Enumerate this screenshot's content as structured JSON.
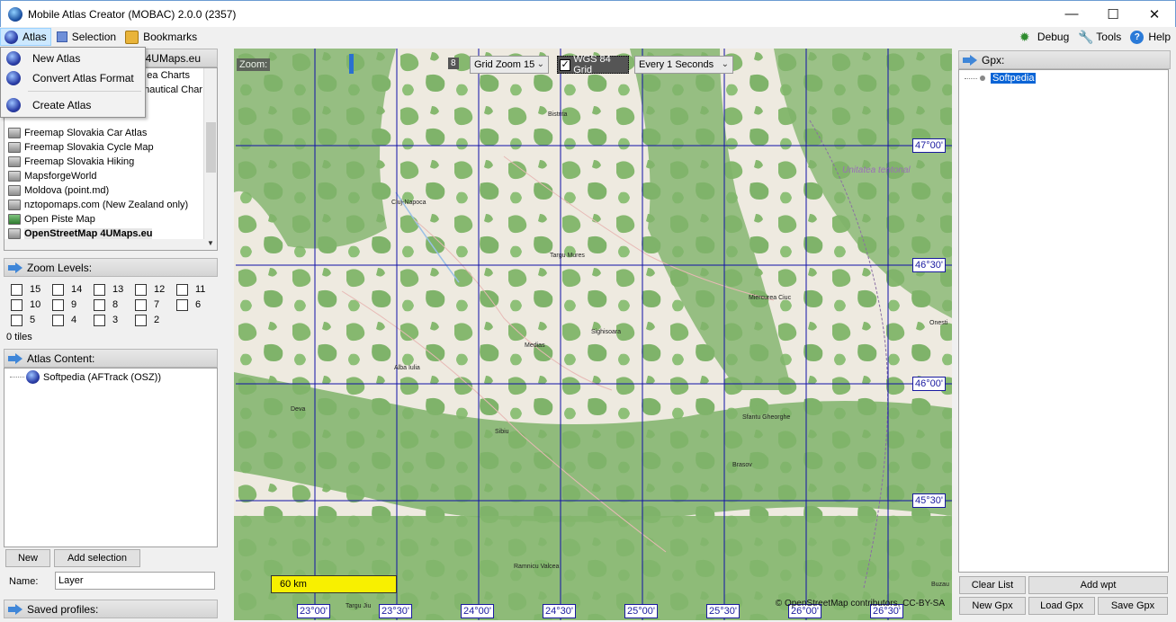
{
  "window": {
    "title": "Mobile Atlas Creator (MOBAC) 2.0.0 (2357)",
    "minimize": "—",
    "maximize": "☐",
    "close": "✕"
  },
  "menubar": {
    "atlas": "Atlas",
    "selection": "Selection",
    "bookmarks": "Bookmarks",
    "debug": "Debug",
    "tools": "Tools",
    "help": "Help"
  },
  "atlas_menu": {
    "new_atlas": "New Atlas",
    "convert_format": "Convert Atlas Format",
    "create_atlas": "Create Atlas"
  },
  "map_source": {
    "header_partial": "p 4UMaps.eu",
    "partial_items": [
      "ea Charts",
      "nautical Char"
    ],
    "items": [
      "Freemap Slovakia Car Atlas",
      "Freemap Slovakia Cycle Map",
      "Freemap Slovakia Hiking",
      "MapsforgeWorld",
      "Moldova (point.md)",
      "nztopomaps.com (New Zealand only)",
      "Open Piste Map",
      "OpenStreetMap 4UMaps.eu"
    ]
  },
  "zoom_levels": {
    "header": "Zoom Levels:",
    "levels": [
      "15",
      "14",
      "13",
      "12",
      "11",
      "10",
      "9",
      "8",
      "7",
      "6",
      "5",
      "4",
      "3",
      "2"
    ],
    "tiles": "0 tiles"
  },
  "atlas_content": {
    "header": "Atlas Content:",
    "item": "Softpedia (AFTrack (OSZ))",
    "new_button": "New",
    "add_selection_button": "Add selection",
    "name_label": "Name:",
    "name_value": "Layer"
  },
  "saved_profiles": {
    "header": "Saved profiles:"
  },
  "map": {
    "zoom_label": "Zoom:",
    "zoom_value": "8",
    "grid_zoom": "Grid Zoom 15",
    "grid_type": "WGS 84 Grid",
    "grid_checked": true,
    "refresh": "Every 1 Seconds",
    "lat_labels": [
      "47°00'",
      "46°30'",
      "46°00'",
      "45°30'"
    ],
    "lon_labels": [
      "23°00'",
      "23°30'",
      "24°00'",
      "24°30'",
      "25°00'",
      "25°30'",
      "26°00'",
      "26°30'"
    ],
    "cities": [
      "Bistrita",
      "Cluj-Napoca",
      "Targu Mures",
      "Miercurea Ciuc",
      "Onesti",
      "Medias",
      "Sighisoara",
      "Alba Iulia",
      "Deva",
      "Sibiu",
      "Sfantu Gheorghe",
      "Brasov",
      "Ramnicu Valcea",
      "Targu Jiu",
      "Buzau"
    ],
    "region_label": "Unitatea tentonal",
    "scale": "60 km",
    "copyright": "© OpenStreetMap contributors, CC-BY-SA",
    "colors": {
      "base": "#eeeae0",
      "forest": "#7fb36a",
      "grid": "#1010a8",
      "scale": "#f8f000"
    }
  },
  "gpx": {
    "header": "Gpx:",
    "item": "Softpedia",
    "clear_list": "Clear List",
    "add_wpt": "Add wpt",
    "new_gpx": "New Gpx",
    "load_gpx": "Load Gpx",
    "save_gpx": "Save Gpx"
  }
}
